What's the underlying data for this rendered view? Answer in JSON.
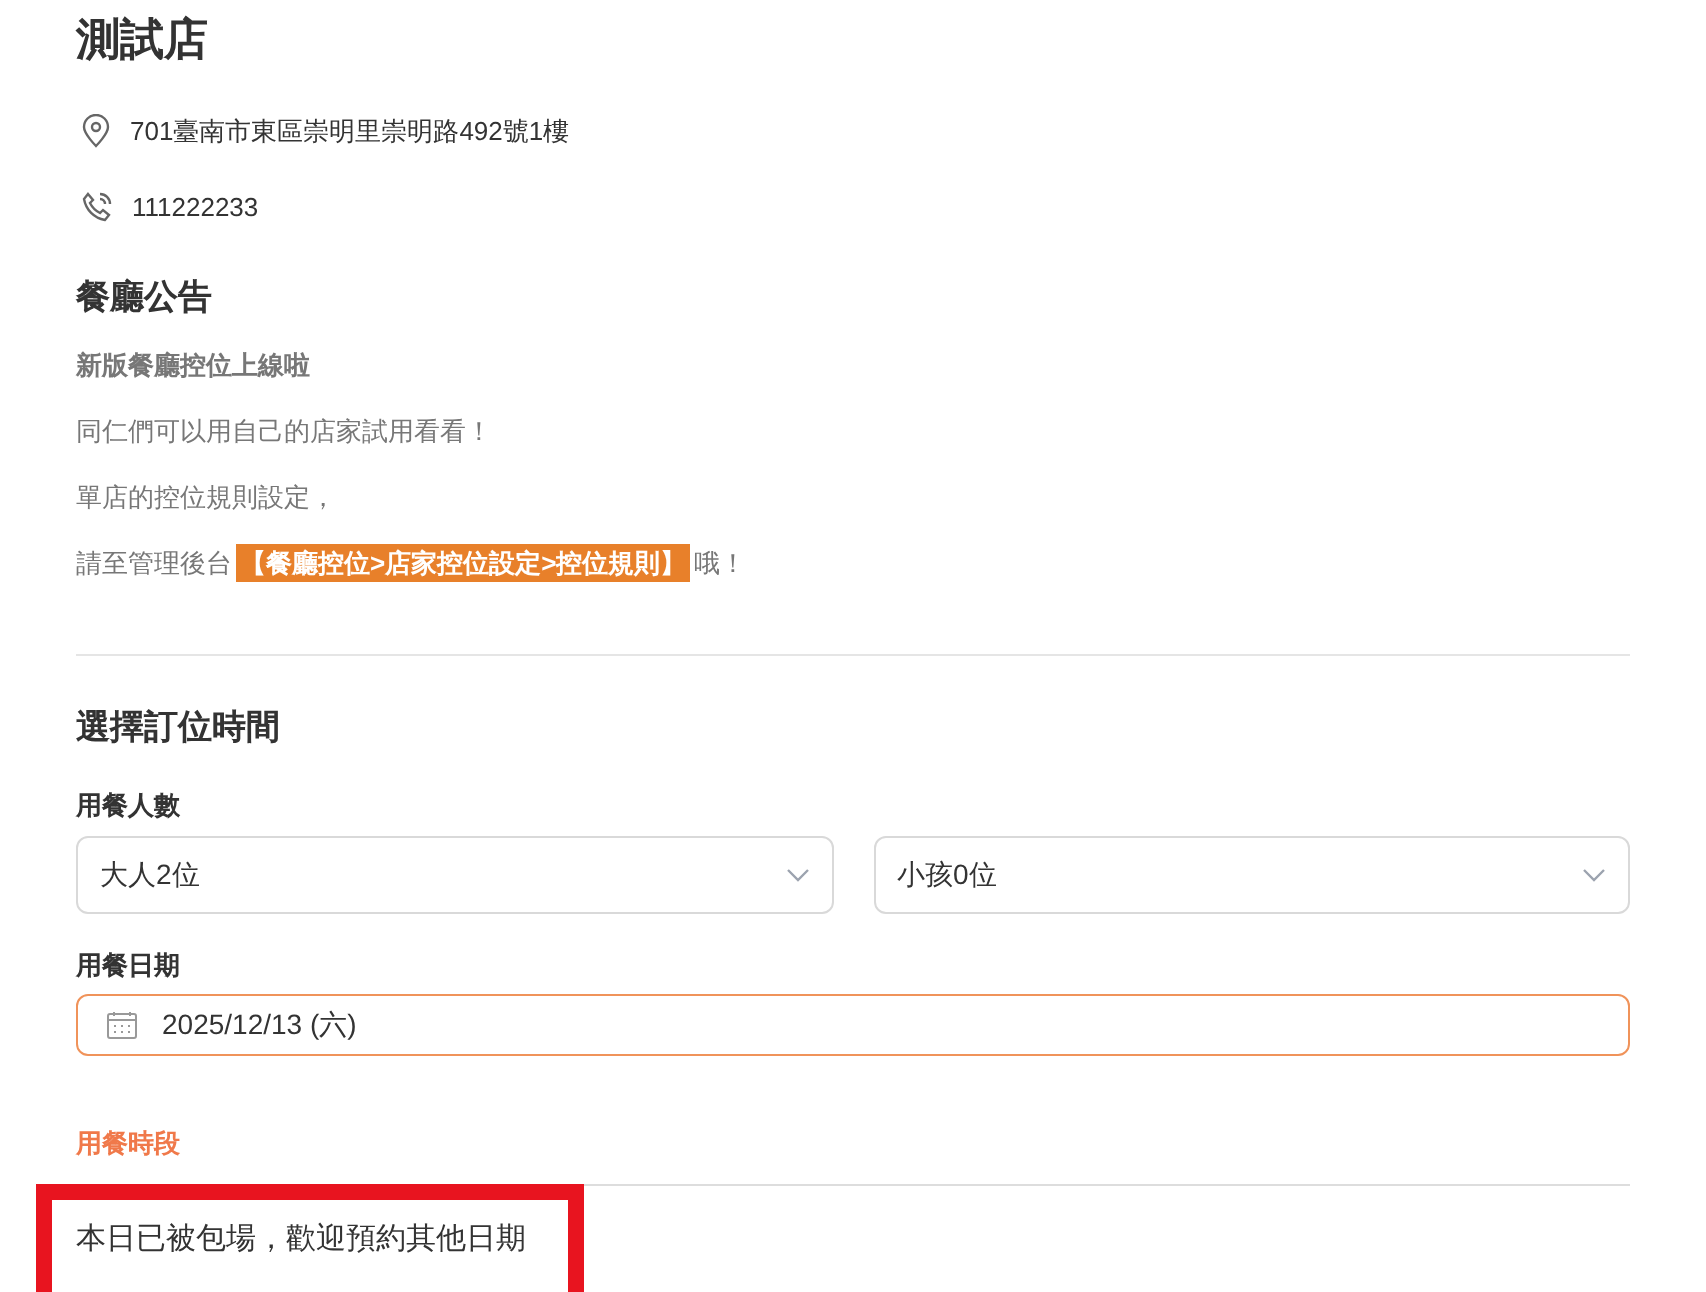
{
  "store": {
    "name": "測試店",
    "address": "701臺南市東區崇明里崇明路492號1樓",
    "phone": "111222233"
  },
  "announcement": {
    "title": "餐廳公告",
    "lines": [
      {
        "bold": true,
        "parts": [
          {
            "text": "新版餐廳控位上線啦",
            "highlight": false
          }
        ]
      },
      {
        "bold": false,
        "parts": [
          {
            "text": "同仁們可以用自己的店家試用看看！",
            "highlight": false
          }
        ]
      },
      {
        "bold": false,
        "parts": [
          {
            "text": "單店的控位規則設定，",
            "highlight": false
          }
        ]
      },
      {
        "bold": false,
        "parts": [
          {
            "text": "請至管理後台",
            "highlight": false
          },
          {
            "text": "【餐廳控位>店家控位設定>控位規則】",
            "highlight": true
          },
          {
            "text": "哦！",
            "highlight": false
          }
        ]
      }
    ]
  },
  "booking": {
    "title": "選擇訂位時間",
    "party_label": "用餐人數",
    "adults": {
      "value": "大人2位"
    },
    "children": {
      "value": "小孩0位"
    },
    "date_label": "用餐日期",
    "date": {
      "value": "2025/12/13 (六)",
      "focused": true
    },
    "period_label": "用餐時段",
    "message": "本日已被包場，歡迎預約其他日期",
    "message_highlighted": true
  }
}
